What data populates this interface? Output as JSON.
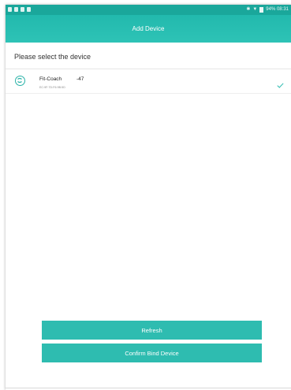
{
  "status_bar": {
    "right_text": "94% 08:31"
  },
  "header": {
    "title": "Add Device"
  },
  "prompt": "Please select the device",
  "device": {
    "name": "Fit-Coach",
    "rssi": "-47",
    "mac": "EC:9F:7D:F6:9B:5D",
    "selected": true
  },
  "buttons": {
    "refresh_label": "Refresh",
    "confirm_label": "Confirm Bind Device"
  },
  "colors": {
    "accent": "#2ebcb0",
    "header": "#22b9ad",
    "status_bar": "#1aa79b"
  }
}
